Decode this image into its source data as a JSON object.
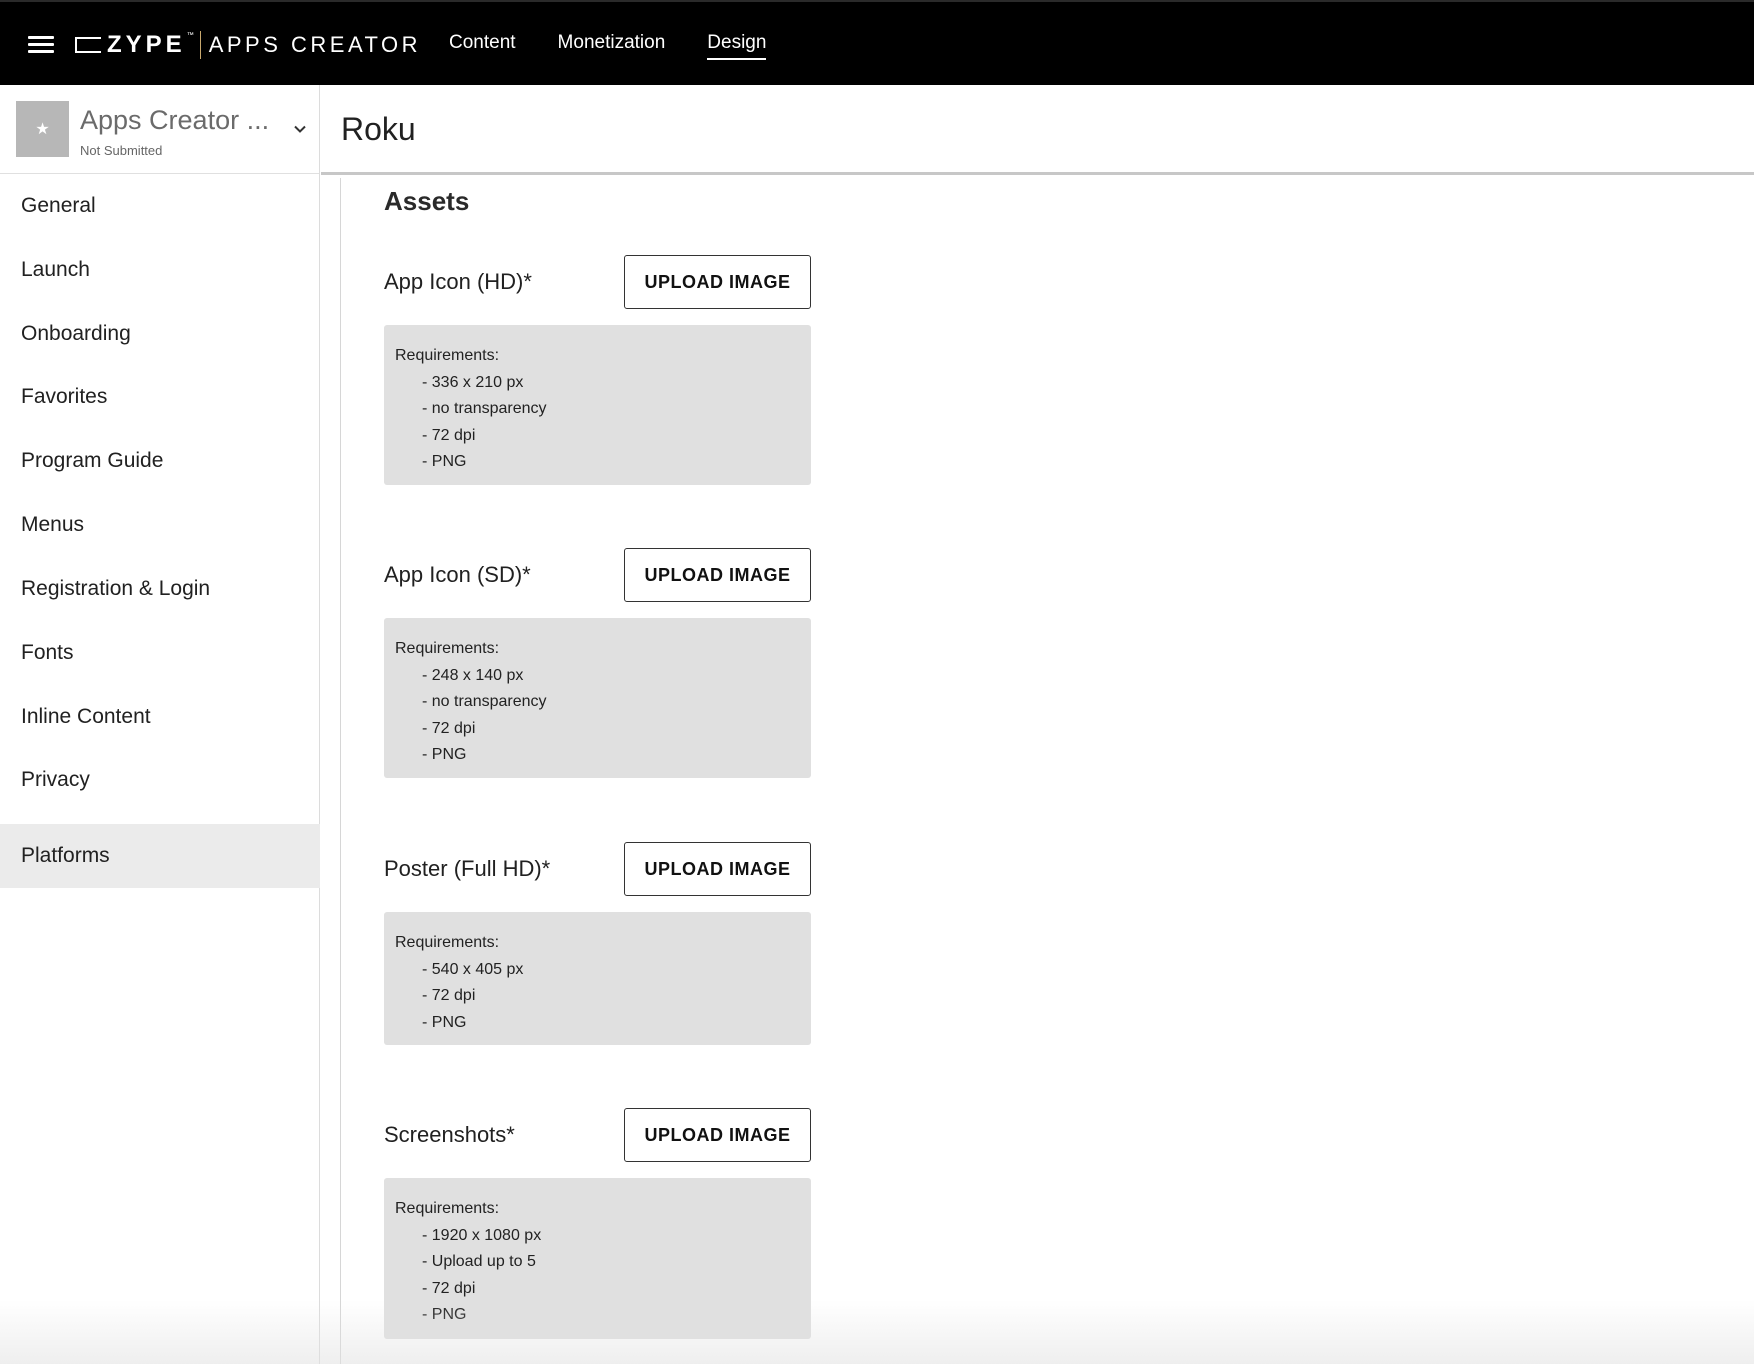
{
  "header": {
    "brand": "ZYPE",
    "trademark": "™",
    "product": "APPS CREATOR",
    "nav": [
      {
        "label": "Content"
      },
      {
        "label": "Monetization"
      },
      {
        "label": "Design"
      }
    ],
    "active_nav": "Design"
  },
  "app": {
    "name": "Apps Creator ...",
    "status": "Not Submitted",
    "avatar_icon": "star-icon"
  },
  "sidebar": {
    "items": [
      {
        "label": "General"
      },
      {
        "label": "Launch"
      },
      {
        "label": "Onboarding"
      },
      {
        "label": "Favorites"
      },
      {
        "label": "Program Guide"
      },
      {
        "label": "Menus"
      },
      {
        "label": "Registration & Login"
      },
      {
        "label": "Fonts"
      },
      {
        "label": "Inline Content"
      },
      {
        "label": "Privacy"
      },
      {
        "label": "Platforms"
      }
    ],
    "active": "Platforms"
  },
  "page": {
    "title": "Roku",
    "section_title": "Assets"
  },
  "assets": [
    {
      "label": "App Icon (HD)*",
      "button": "UPLOAD IMAGE",
      "requirements_title": "Requirements:",
      "requirements": [
        "- 336 x 210 px",
        "- no transparency",
        "- 72 dpi",
        "- PNG"
      ]
    },
    {
      "label": "App Icon (SD)*",
      "button": "UPLOAD IMAGE",
      "requirements_title": "Requirements:",
      "requirements": [
        "- 248 x 140 px",
        "- no transparency",
        "- 72 dpi",
        "- PNG"
      ]
    },
    {
      "label": "Poster (Full HD)*",
      "button": "UPLOAD IMAGE",
      "requirements_title": "Requirements:",
      "requirements": [
        "- 540 x 405 px",
        "- 72 dpi",
        "- PNG"
      ]
    },
    {
      "label": "Screenshots*",
      "button": "UPLOAD IMAGE",
      "requirements_title": "Requirements:",
      "requirements": [
        "- 1920 x 1080 px",
        "- Upload up to 5",
        "- 72 dpi",
        "- PNG"
      ]
    }
  ],
  "colors": {
    "topbar": "#000000",
    "active_sidebar": "#ebebeb",
    "requirements_bg": "#e0e0e0",
    "logo_divider": "#c9a96e"
  }
}
